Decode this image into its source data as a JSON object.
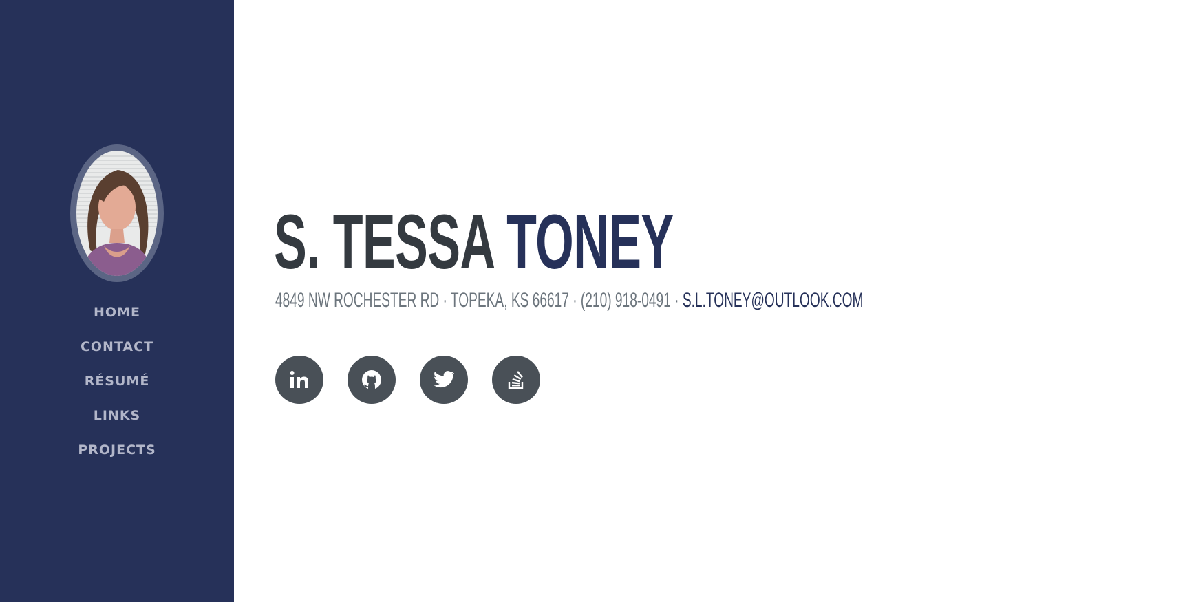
{
  "colors": {
    "sidebar_bg": "#263159",
    "nav_text": "#b2b6c9",
    "name_first": "#343a40",
    "name_last": "#263159",
    "subheading": "#6c757d",
    "social_bg": "#495057"
  },
  "sidebar": {
    "avatar_alt": "profile photo",
    "nav": [
      {
        "label": "HOME"
      },
      {
        "label": "CONTACT"
      },
      {
        "label": "RÉSUMÉ"
      },
      {
        "label": "LINKS"
      },
      {
        "label": "PROJECTS"
      }
    ]
  },
  "main": {
    "first_name": "S. TESSA",
    "last_name": "TONEY",
    "address": "4849 NW ROCHESTER RD · TOPEKA, KS 66617 · (210) 918-0491 ·",
    "email": "S.L.TONEY@OUTLOOK.COM",
    "social": [
      {
        "icon": "linkedin-icon"
      },
      {
        "icon": "github-icon"
      },
      {
        "icon": "twitter-icon"
      },
      {
        "icon": "stack-overflow-icon"
      }
    ]
  }
}
